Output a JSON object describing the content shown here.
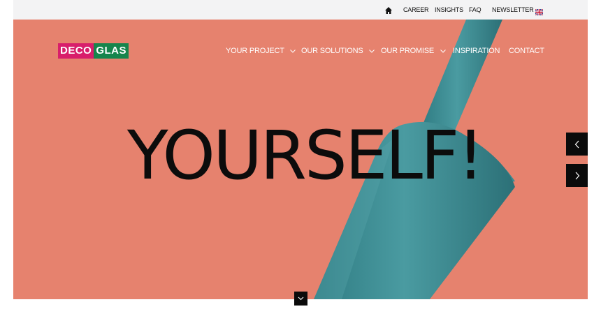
{
  "topbar": {
    "home_icon": "home-icon",
    "links": [
      "CAREER",
      "INSIGHTS",
      "FAQ",
      "NEWSLETTER"
    ],
    "language_icon": "uk-flag-icon"
  },
  "logo": {
    "part1": "DECO",
    "part2": "GLAS",
    "colors": {
      "deco": "#d81e6b",
      "glas": "#16854c"
    }
  },
  "nav": {
    "items": [
      {
        "label": "YOUR PROJECT",
        "has_dropdown": true
      },
      {
        "label": "OUR SOLUTIONS",
        "has_dropdown": true
      },
      {
        "label": "OUR PROMISE",
        "has_dropdown": true
      },
      {
        "label": "INSPIRATION",
        "has_dropdown": false
      },
      {
        "label": "CONTACT",
        "has_dropdown": false
      }
    ]
  },
  "hero": {
    "headline": "YOURSELF!",
    "background_color": "#e6826e",
    "bottle_color": "#3a8a91"
  },
  "controls": {
    "prev_icon": "chevron-left-icon",
    "next_icon": "chevron-right-icon",
    "scroll_icon": "chevron-down-icon"
  }
}
